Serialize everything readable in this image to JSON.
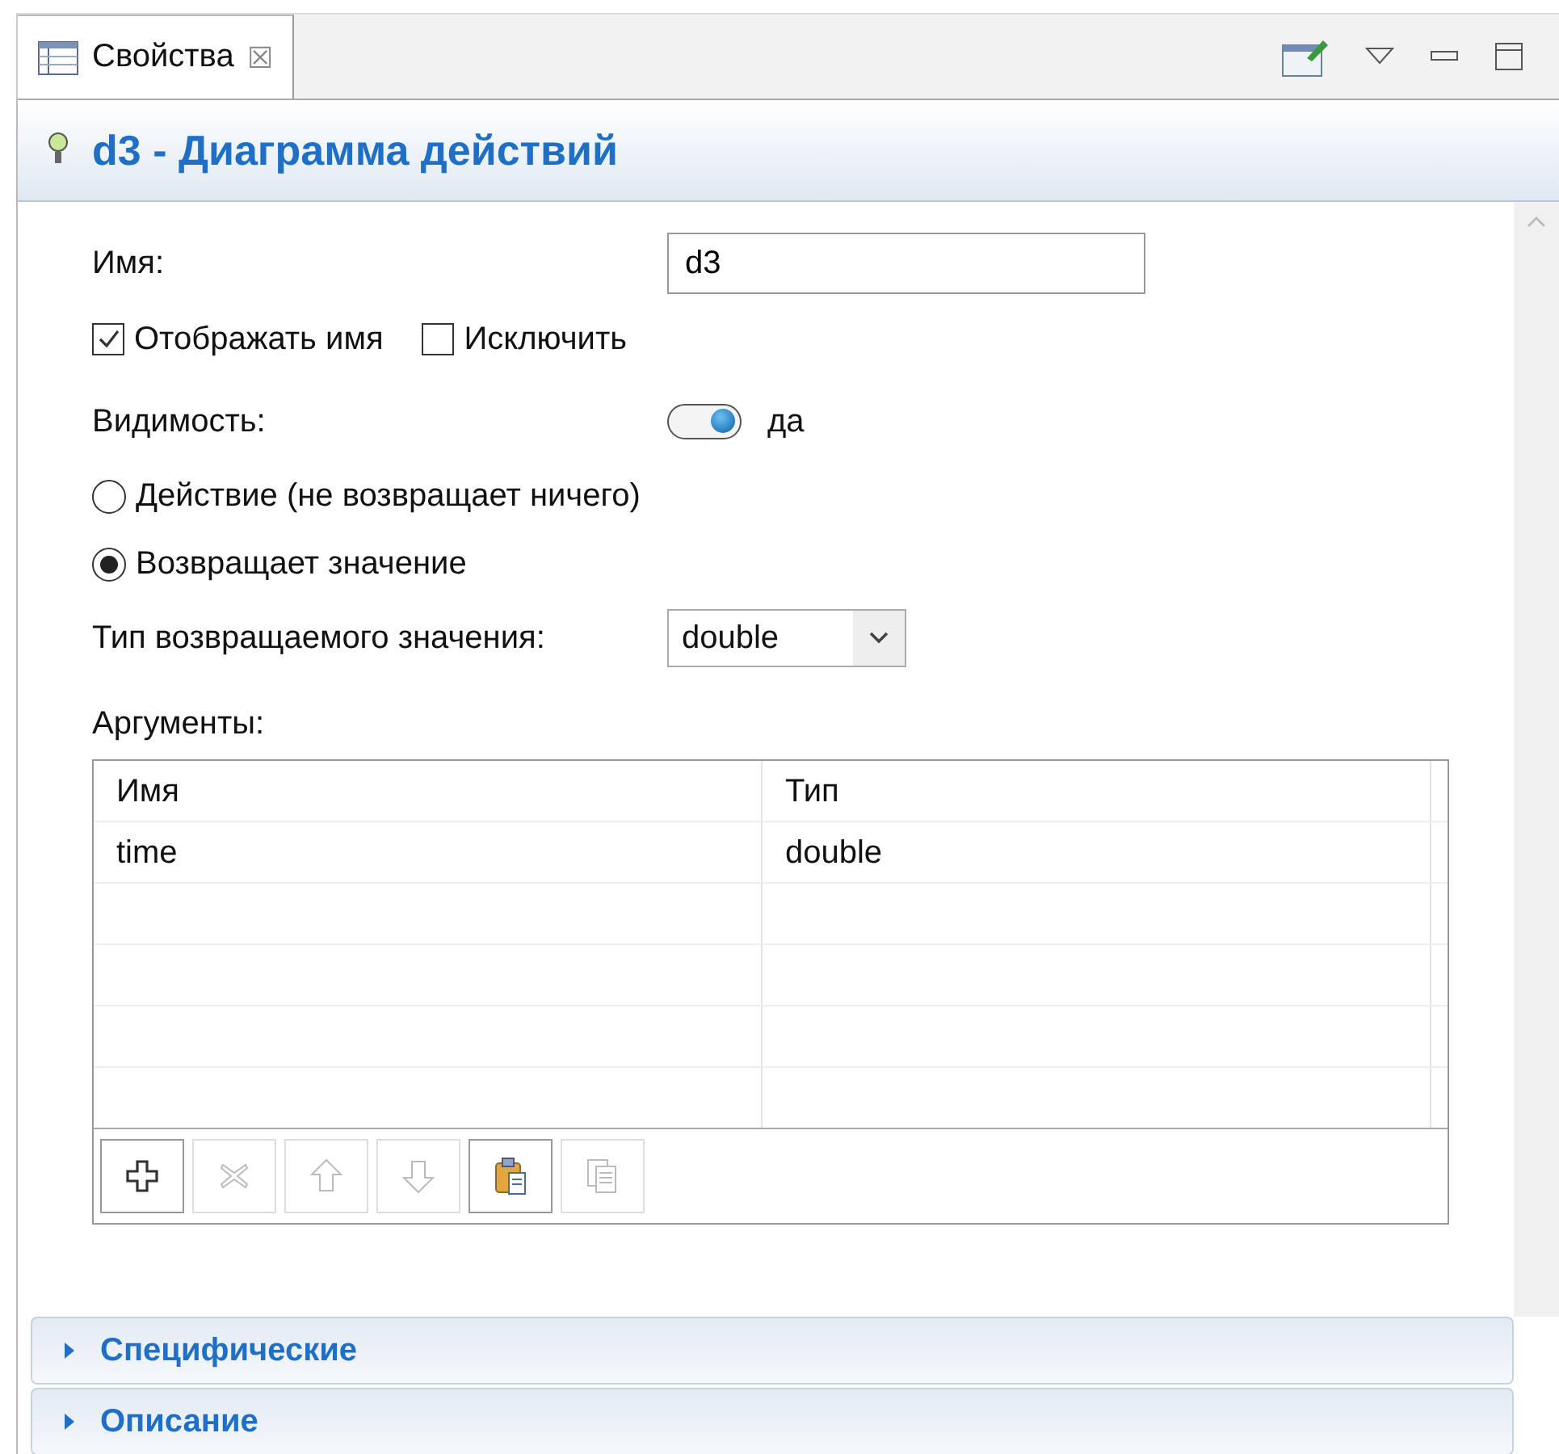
{
  "tab": {
    "label": "Свойства",
    "close": "☒"
  },
  "header": {
    "title": "d3 - Диаграмма действий"
  },
  "name_field": {
    "label": "Имя:",
    "value": "d3"
  },
  "checkboxes": [
    {
      "label": "Отображать имя",
      "checked": true
    },
    {
      "label": "Исключить",
      "checked": false
    }
  ],
  "visibility": {
    "label": "Видимость:",
    "on": true,
    "value": "да"
  },
  "radios": [
    {
      "label": "Действие (не возвращает ничего)",
      "selected": false
    },
    {
      "label": "Возвращает значение",
      "selected": true
    }
  ],
  "return_type": {
    "label": "Тип возвращаемого значения:",
    "value": "double"
  },
  "arguments": {
    "label": "Аргументы:",
    "columns": [
      "Имя",
      "Тип"
    ],
    "rows": [
      [
        "time",
        "double"
      ]
    ],
    "toolbar": [
      {
        "kind": "add",
        "disabled": false
      },
      {
        "kind": "delete",
        "disabled": true
      },
      {
        "kind": "up",
        "disabled": true
      },
      {
        "kind": "down",
        "disabled": true
      },
      {
        "kind": "paste",
        "disabled": false
      },
      {
        "kind": "copy",
        "disabled": true
      }
    ]
  },
  "sections": [
    {
      "label": "Специфические",
      "expanded": false
    },
    {
      "label": "Описание",
      "expanded": false
    }
  ]
}
